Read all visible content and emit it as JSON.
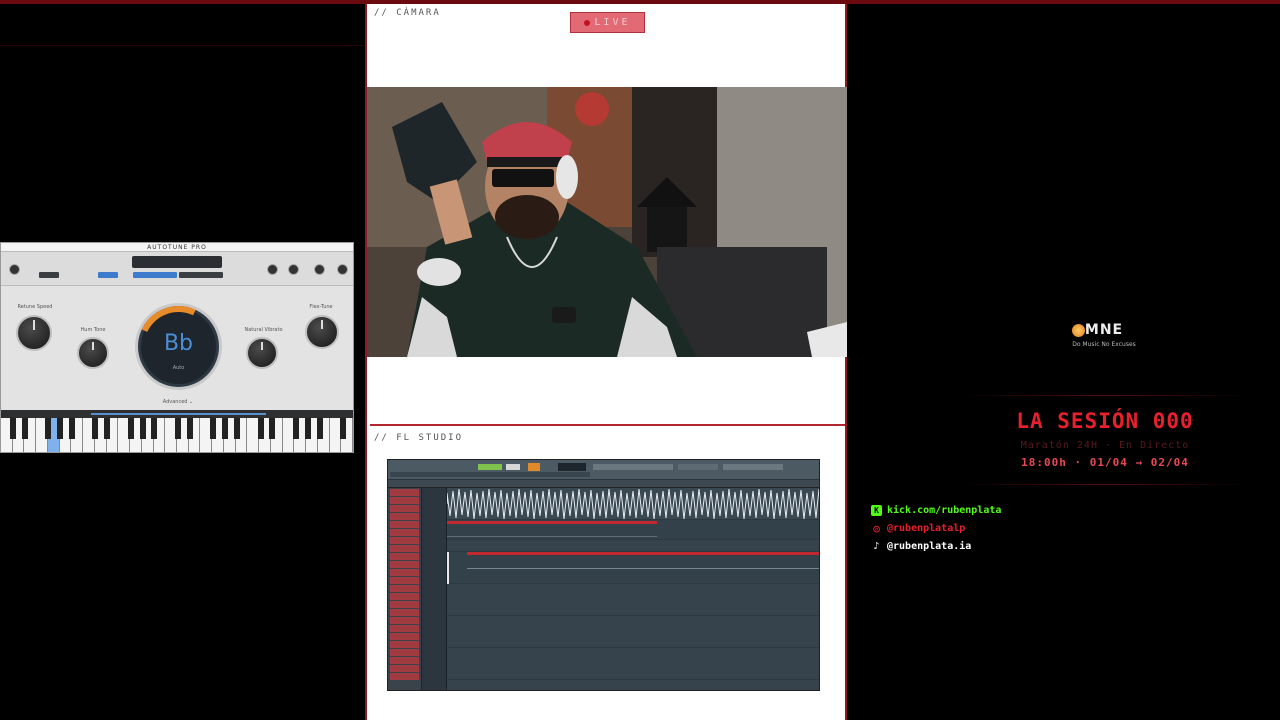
{
  "camera_section": {
    "label": "// CÁMARA",
    "live_label": "LIVE"
  },
  "fl_section": {
    "label": "// FL STUDIO"
  },
  "autotune": {
    "title": "AUTOTUNE PRO",
    "note": "Bb",
    "mode": "Auto",
    "knobs": [
      "Retune Speed",
      "Hum Tone",
      "Natural Vibrato",
      "Flex-Tune"
    ],
    "advanced_label": "Advanced ⌄"
  },
  "brand": {
    "logo_text": "MNE",
    "tagline": "Do Music No Excuses"
  },
  "session": {
    "title": "LA SESIÓN 000",
    "subtitle": "Maratón 24H · En Directo",
    "date": "18:00h · 01/04 → 02/04"
  },
  "socials": [
    {
      "icon": "kick-icon",
      "glyph": "K",
      "text": "kick.com/rubenplata",
      "color": "#53fc18"
    },
    {
      "icon": "instagram-icon",
      "glyph": "◎",
      "text": "@rubenplatalp",
      "color": "#e8202e"
    },
    {
      "icon": "tiktok-icon",
      "glyph": "♪",
      "text": "@rubenplata.ia",
      "color": "#ffffff"
    }
  ],
  "colors": {
    "accent_red": "#e8202e",
    "dark_red": "#6b0b10",
    "kick_green": "#53fc18"
  }
}
